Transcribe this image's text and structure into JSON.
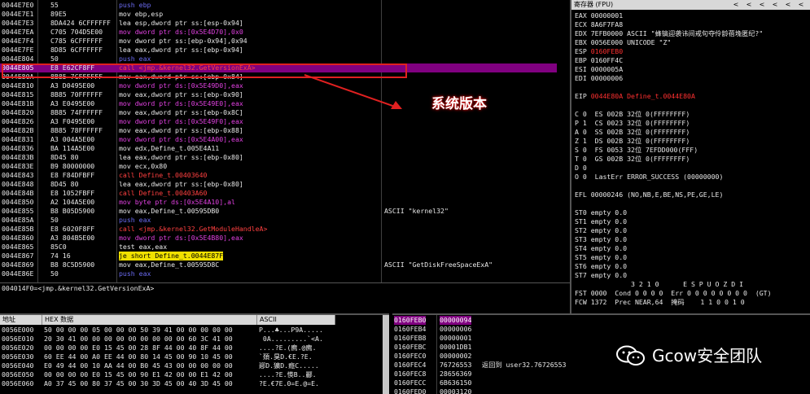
{
  "disasm": {
    "rows": [
      [
        "0044E7E0",
        "55",
        "push ebp",
        ""
      ],
      [
        "0044E7E1",
        "89E5",
        "mov ebp,esp",
        ""
      ],
      [
        "0044E7E3",
        "8DA424 6CFFFFFF",
        "lea esp,dword ptr ss:[esp-0x94]",
        ""
      ],
      [
        "0044E7EA",
        "C705 704D5E00",
        "mov dword ptr ds:[0x5E4D70],0x0",
        ""
      ],
      [
        "0044E7F4",
        "C785 6CFFFFFF",
        "mov dword ptr ss:[ebp-0x94],0x94",
        ""
      ],
      [
        "0044E7FE",
        "8D85 6CFFFFFF",
        "lea eax,dword ptr ss:[ebp-0x94]",
        ""
      ],
      [
        "0044E804",
        "50",
        "push eax",
        ""
      ],
      [
        "0044E805",
        "E8 E62CF8FF",
        "call <jmp.&kernel32.GetVersionExA>",
        ""
      ],
      [
        "0044E80A",
        "8B85 7CFFFFFF",
        "mov eax,dword ptr ss:[ebp-0x84]",
        ""
      ],
      [
        "0044E810",
        "A3 D0495E00",
        "mov dword ptr ds:[0x5E49D0],eax",
        ""
      ],
      [
        "0044E815",
        "8B85 70FFFFFF",
        "mov eax,dword ptr ss:[ebp-0x90]",
        ""
      ],
      [
        "0044E81B",
        "A3 E0495E00",
        "mov dword ptr ds:[0x5E49E0],eax",
        ""
      ],
      [
        "0044E820",
        "8B85 74FFFFFF",
        "mov eax,dword ptr ss:[ebp-0x8C]",
        ""
      ],
      [
        "0044E826",
        "A3 F0495E00",
        "mov dword ptr ds:[0x5E49F0],eax",
        ""
      ],
      [
        "0044E82B",
        "8B85 78FFFFFF",
        "mov eax,dword ptr ss:[ebp-0x88]",
        ""
      ],
      [
        "0044E831",
        "A3 004A5E00",
        "mov dword ptr ds:[0x5E4A00],eax",
        ""
      ],
      [
        "0044E836",
        "BA 114A5E00",
        "mov edx,Define_t.005E4A11",
        ""
      ],
      [
        "0044E83B",
        "8D45 80",
        "lea eax,dword ptr ss:[ebp-0x80]",
        ""
      ],
      [
        "0044E83E",
        "B9 80000000",
        "mov ecx,0x80",
        ""
      ],
      [
        "0044E843",
        "E8 F84DFBFF",
        "call Define_t.00403640",
        ""
      ],
      [
        "0044E848",
        "8D45 80",
        "lea eax,dword ptr ss:[ebp-0x80]",
        ""
      ],
      [
        "0044E84B",
        "E8 1052FBFF",
        "call Define_t.00403A60",
        ""
      ],
      [
        "0044E850",
        "A2 104A5E00",
        "mov byte ptr ds:[0x5E4A10],al",
        ""
      ],
      [
        "0044E855",
        "B8 B05D5900",
        "mov eax,Define_t.00595DB0",
        "ASCII \"kernel32\""
      ],
      [
        "0044E85A",
        "50",
        "push eax",
        ""
      ],
      [
        "0044E85B",
        "E8 6020F8FF",
        "call <jmp.&kernel32.GetModuleHandleA>",
        ""
      ],
      [
        "0044E860",
        "A3 804B5E00",
        "mov dword ptr ds:[0x5E4B80],eax",
        ""
      ],
      [
        "0044E865",
        "85C0",
        "test eax,eax",
        ""
      ],
      [
        "0044E867",
        "74 16",
        "je short Define_t.0044E87F",
        ""
      ],
      [
        "0044E869",
        "B8 8C5D5900",
        "mov eax,Define_t.00595D8C",
        "ASCII \"GetDiskFreeSpaceExA\""
      ],
      [
        "0044E86E",
        "50",
        "push eax",
        ""
      ]
    ],
    "info_line": "004014F0=<jmp.&kernel32.GetVersionExA>",
    "annotation": "系统版本"
  },
  "registers": {
    "title": "寄存器 (FPU)",
    "title_buttons": [
      "<",
      "<",
      "<",
      "<",
      "<",
      "<"
    ],
    "lines": [
      [
        "EAX 00000001",
        ""
      ],
      [
        "ECX 8A6F7FA8",
        ""
      ],
      [
        "EDX 7EFB0000 ASCII \"蜂镐迎袭讳间戒句夺伶龄蓓堍匿纪?\"",
        ""
      ],
      [
        "EBX 0056E000 UNICODE \"Z\"",
        ""
      ],
      [
        "ESP ",
        "0160FEB0"
      ],
      [
        "EBP 0160FF4C",
        ""
      ],
      [
        "ESI 0000005A",
        ""
      ],
      [
        "EDI 00000006",
        ""
      ],
      [
        "",
        ""
      ],
      [
        "EIP ",
        "0044E80A Define_t.0044E80A"
      ],
      [
        "",
        ""
      ],
      [
        "C 0  ES 002B 32位 0(FFFFFFFF)",
        ""
      ],
      [
        "P 1  CS 0023 32位 0(FFFFFFFF)",
        ""
      ],
      [
        "A 0  SS 002B 32位 0(FFFFFFFF)",
        ""
      ],
      [
        "Z 1  DS 002B 32位 0(FFFFFFFF)",
        ""
      ],
      [
        "S 0  FS 0053 32位 7EFDD000(FFF)",
        ""
      ],
      [
        "T 0  GS 002B 32位 0(FFFFFFFF)",
        ""
      ],
      [
        "D 0",
        ""
      ],
      [
        "O 0  LastErr ERROR_SUCCESS (00000000)",
        ""
      ],
      [
        "",
        ""
      ],
      [
        "EFL 00000246 (NO,NB,E,BE,NS,PE,GE,LE)",
        ""
      ],
      [
        "",
        ""
      ],
      [
        "ST0 empty 0.0",
        ""
      ],
      [
        "ST1 empty 0.0",
        ""
      ],
      [
        "ST2 empty 0.0",
        ""
      ],
      [
        "ST3 empty 0.0",
        ""
      ],
      [
        "ST4 empty 0.0",
        ""
      ],
      [
        "ST5 empty 0.0",
        ""
      ],
      [
        "ST6 empty 0.0",
        ""
      ],
      [
        "ST7 empty 0.0",
        ""
      ],
      [
        "              3 2 1 0      E S P U O Z D I",
        ""
      ],
      [
        "FST 0000  Cond 0 0 0 0  Err 0 0 0 0 0 0 0 0  (GT)",
        ""
      ],
      [
        "FCW 1372  Prec NEAR,64  掩码    1 1 0 0 1 0",
        ""
      ]
    ]
  },
  "dump": {
    "header_addr": "地址",
    "header_hex": "HEX 数据",
    "header_ascii": "ASCII",
    "rows": [
      [
        "0056E000",
        "50 00 00 00 05 00 00 00 50 39 41 00 00 00 00 00",
        "P...♣...P9A....."
      ],
      [
        "0056E010",
        "20 30 41 00 00 00 00 00 00 00 00 00 60 3C 41 00",
        " 0A.........`<A."
      ],
      [
        "0056E020",
        "00 00 00 00 E0 15 45 00 28 8F 44 00 40 8F 44 00",
        "....?E.(廌.@廌."
      ],
      [
        "0056E030",
        "60 EE 44 00 A0 EE 44 00 80 14 45 00 90 10 45 00",
        "`頚.狊D.€E.?E."
      ],
      [
        "0056E040",
        "E0 49 44 00 10 AA 44 00 B0 45 43 00 00 00 00 00",
        "郔D.獷D.癊C....."
      ],
      [
        "0056E050",
        "00 00 00 00 E0 15 45 00 90 E1 42 00 00 E1 42 00",
        "....?E.愥B..酈."
      ],
      [
        "0056E060",
        "A0 37 45 00 80 37 45 00 30 3D 45 00 40 3D 45 00",
        "?E.€7E.0=E.@=E."
      ]
    ]
  },
  "stack": {
    "rows": [
      [
        "0160FEB0",
        "00000094",
        ""
      ],
      [
        "0160FEB4",
        "00000006",
        ""
      ],
      [
        "0160FEB8",
        "00000001",
        ""
      ],
      [
        "0160FEBC",
        "00001DB1",
        ""
      ],
      [
        "0160FEC0",
        "00000002",
        ""
      ],
      [
        "0160FEC4",
        "76726553",
        "返回到 user32.76726553"
      ],
      [
        "0160FEC8",
        "28656369",
        ""
      ],
      [
        "0160FECC",
        "6B636150",
        ""
      ],
      [
        "0160FED0",
        "00003120",
        ""
      ]
    ]
  },
  "watermark": {
    "text": "Gcow安全团队",
    "icon": "wechat-icon"
  },
  "colors": {
    "selection": "#800080",
    "highlight_box": "#e02020",
    "keyword": "#6a6af0",
    "memory": "#e040e0",
    "call": "#ff4040"
  }
}
